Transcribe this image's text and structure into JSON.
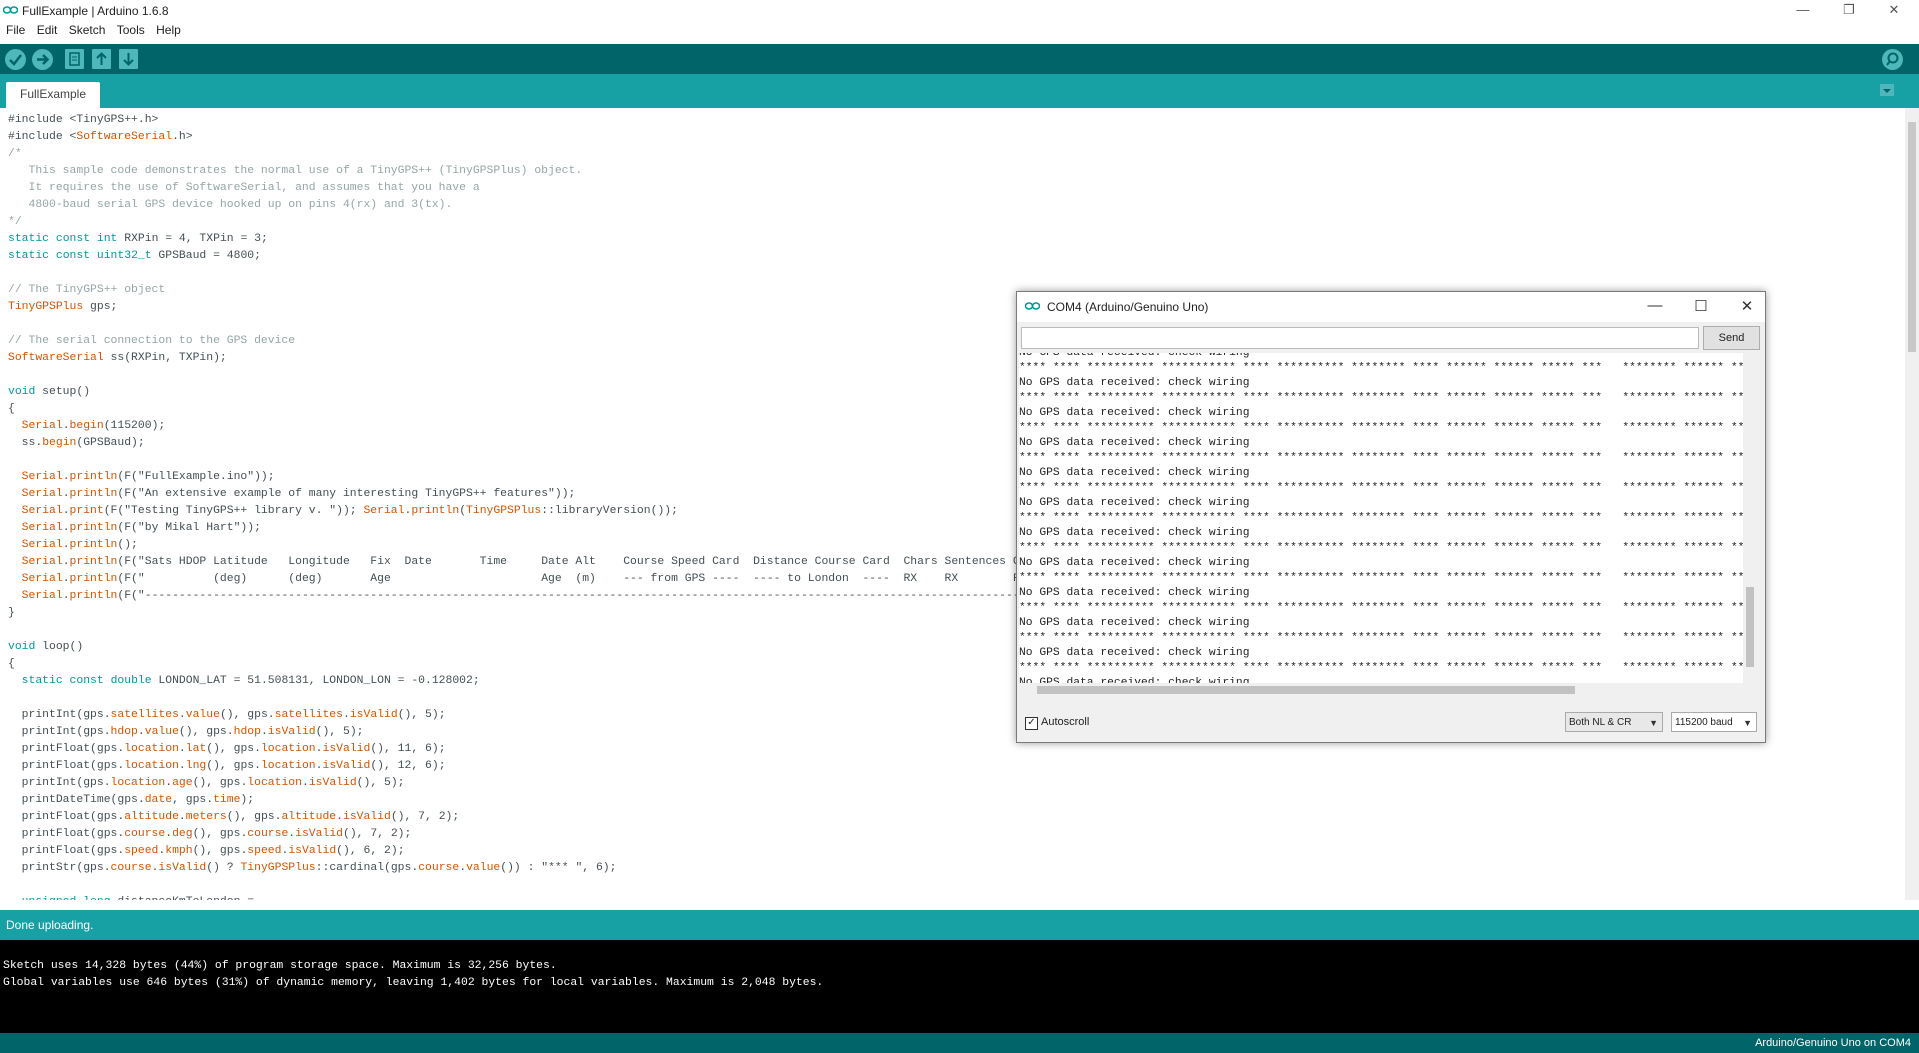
{
  "window": {
    "title": "FullExample | Arduino 1.6.8",
    "min": "—",
    "restore": "❐",
    "close": "✕"
  },
  "menu": [
    "File",
    "Edit",
    "Sketch",
    "Tools",
    "Help"
  ],
  "tab": {
    "label": "FullExample"
  },
  "code_lines": [
    "#include <TinyGPS++.h>",
    "#include <SoftwareSerial.h>",
    "/*",
    "   This sample code demonstrates the normal use of a TinyGPS++ (TinyGPSPlus) object.",
    "   It requires the use of SoftwareSerial, and assumes that you have a",
    "   4800-baud serial GPS device hooked up on pins 4(rx) and 3(tx).",
    "*/",
    "static const int RXPin = 4, TXPin = 3;",
    "static const uint32_t GPSBaud = 4800;",
    "",
    "// The TinyGPS++ object",
    "TinyGPSPlus gps;",
    "",
    "// The serial connection to the GPS device",
    "SoftwareSerial ss(RXPin, TXPin);",
    "",
    "void setup()",
    "{",
    "  Serial.begin(115200);",
    "  ss.begin(GPSBaud);",
    "",
    "  Serial.println(F(\"FullExample.ino\"));",
    "  Serial.println(F(\"An extensive example of many interesting TinyGPS++ features\"));",
    "  Serial.print(F(\"Testing TinyGPS++ library v. \")); Serial.println(TinyGPSPlus::libraryVersion());",
    "  Serial.println(F(\"by Mikal Hart\"));",
    "  Serial.println();",
    "  Serial.println(F(\"Sats HDOP Latitude   Longitude   Fix  Date       Time     Date Alt    Course Speed Card  Distance Course Card  Chars Sentences Checksum\"));",
    "  Serial.println(F(\"          (deg)      (deg)       Age                      Age  (m)    --- from GPS ----  ---- to London  ----  RX    RX        Fail\"));",
    "  Serial.println(F(\"---------------------------------------------------------------------------------------------------------------------------------------\"));",
    "}",
    "",
    "void loop()",
    "{",
    "  static const double LONDON_LAT = 51.508131, LONDON_LON = -0.128002;",
    "",
    "  printInt(gps.satellites.value(), gps.satellites.isValid(), 5);",
    "  printInt(gps.hdop.value(), gps.hdop.isValid(), 5);",
    "  printFloat(gps.location.lat(), gps.location.isValid(), 11, 6);",
    "  printFloat(gps.location.lng(), gps.location.isValid(), 12, 6);",
    "  printInt(gps.location.age(), gps.location.isValid(), 5);",
    "  printDateTime(gps.date, gps.time);",
    "  printFloat(gps.altitude.meters(), gps.altitude.isValid(), 7, 2);",
    "  printFloat(gps.course.deg(), gps.course.isValid(), 7, 2);",
    "  printFloat(gps.speed.kmph(), gps.speed.isValid(), 6, 2);",
    "  printStr(gps.course.isValid() ? TinyGPSPlus::cardinal(gps.course.value()) : \"*** \", 6);",
    "",
    "  unsigned long distanceKmToLondon ="
  ],
  "status": {
    "message": "Done uploading."
  },
  "console_lines": [
    "Sketch uses 14,328 bytes (44%) of program storage space. Maximum is 32,256 bytes.",
    "Global variables use 646 bytes (31%) of dynamic memory, leaving 1,402 bytes for local variables. Maximum is 2,048 bytes."
  ],
  "board": "Arduino/Genuino Uno on COM4",
  "serial_monitor": {
    "title": "COM4 (Arduino/Genuino Uno)",
    "send_label": "Send",
    "input_value": "",
    "output_lines": [
      "No GPS data received: check wiring",
      "**** **** ********** *********** **** ********** ******** **** ****** ****** ***** ***   ******** ****** ***",
      "No GPS data received: check wiring",
      "**** **** ********** *********** **** ********** ******** **** ****** ****** ***** ***   ******** ****** ***",
      "No GPS data received: check wiring",
      "**** **** ********** *********** **** ********** ******** **** ****** ****** ***** ***   ******** ****** ***",
      "No GPS data received: check wiring",
      "**** **** ********** *********** **** ********** ******** **** ****** ****** ***** ***   ******** ****** ***",
      "No GPS data received: check wiring",
      "**** **** ********** *********** **** ********** ******** **** ****** ****** ***** ***   ******** ****** ***",
      "No GPS data received: check wiring",
      "**** **** ********** *********** **** ********** ******** **** ****** ****** ***** ***   ******** ****** ***",
      "No GPS data received: check wiring",
      "**** **** ********** *********** **** ********** ******** **** ****** ****** ***** ***   ******** ****** ***",
      "No GPS data received: check wiring",
      "**** **** ********** *********** **** ********** ******** **** ****** ****** ***** ***   ******** ****** ***",
      "No GPS data received: check wiring",
      "**** **** ********** *********** **** ********** ******** **** ****** ****** ***** ***   ******** ****** ***",
      "No GPS data received: check wiring",
      "**** **** ********** *********** **** ********** ******** **** ****** ****** ***** ***   ******** ****** ***",
      "No GPS data received: check wiring",
      "**** **** ********** *********** **** ********** ******** **** ****** ****** ***** ***   ******** ****** ***",
      "No GPS data received: check wiring",
      "**** **** ********** *********** **** ********** ******** **** ****** ****** ***** ***   ******** ****** ***"
    ],
    "autoscroll_label": "Autoscroll",
    "line_ending": "Both NL & CR",
    "baud": "115200 baud"
  },
  "colors": {
    "toolbar": "#006468",
    "tabbar": "#17a1a5",
    "keyword": "#00979c",
    "function": "#d35400",
    "comment": "#95a5a6"
  }
}
